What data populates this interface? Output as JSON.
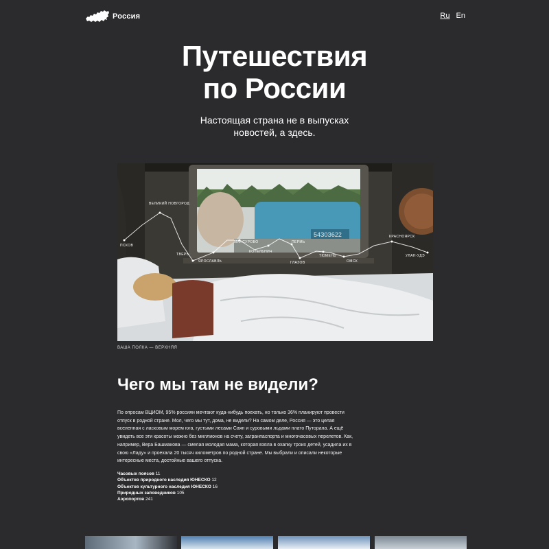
{
  "header": {
    "logo_text": "Россия",
    "languages": [
      {
        "label": "Ru",
        "active": true
      },
      {
        "label": "En",
        "active": false
      }
    ]
  },
  "hero": {
    "title_line1": "Путешествия",
    "title_line2": "по России",
    "subtitle": "Настоящая страна не в выпусках новостей, а здесь."
  },
  "photo": {
    "caption": "ВАША ПОЛКА — ВЕРХНЯЯ",
    "car_number": "54З0З622",
    "route_labels": [
      "ВЕЛИКИЙ НОВГОРОД",
      "ПСКОВ",
      "ТВЕРЬ",
      "ЯРОСЛАВЛЬ",
      "МАНСУРОВО",
      "КОТЕЛЬНИЧ",
      "ПЕРМЬ",
      "ГЛАЗОВ",
      "ТЮМЕНЬ",
      "ОМСК",
      "КРАСНОЯРСК",
      "УЛАН-УДЭ"
    ]
  },
  "section": {
    "title": "Чего мы там не видели?",
    "body": "По опросам ВЦИОМ, 95% россиян мечтают куда-нибудь поехать, но только 36% планируют провести отпуск в родной стране. Мол, чего мы тут, дома, не видели? На самом деле, Россия — это целая вселенная с ласковым морем юга, густыми лесами Саян и суровыми льдами плато Путорана. А ещё увидеть все эти красоты можно без миллионов на счету, загранпаспорта и многочасовых перелетов. Как, например, Вера Башмакова — смелая молодая мама, которая взяла в охапку троих детей, усадила их в свою «Ладу» и проехала 20 тысяч километров по родной стране. Мы выбрали и описали некоторые интересные места, достойные вашего отпуска.",
    "stats": [
      {
        "label": "Часовых поясов",
        "value": "11"
      },
      {
        "label": "Объектов природного наследия ЮНЕСКО",
        "value": "12"
      },
      {
        "label": "Объектов культурного наследия ЮНЕСКО",
        "value": "16"
      },
      {
        "label": "Природных заповедников",
        "value": "105"
      },
      {
        "label": "Аэропортов",
        "value": "241"
      }
    ]
  },
  "colors": {
    "background": "#2b2b2e",
    "text": "#ffffff"
  }
}
